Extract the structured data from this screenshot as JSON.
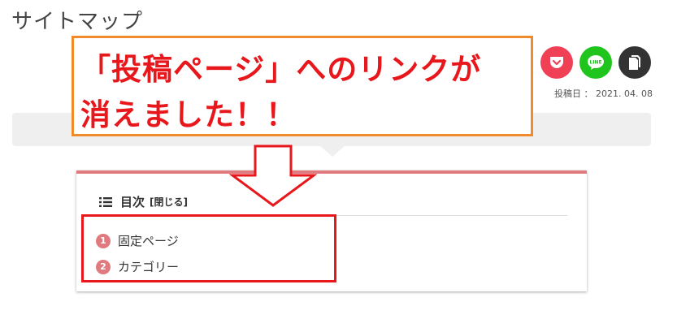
{
  "page": {
    "title": "サイトマップ"
  },
  "share": {
    "pocket_icon": "pocket-icon",
    "line_icon": "line-icon",
    "line_label": "LINE",
    "copy_icon": "copy-icon"
  },
  "post": {
    "date_label": "投稿日 ： 2021. 04. 08"
  },
  "callout": {
    "line1": "「投稿ページ」へのリンクが",
    "line2": "消えました！！",
    "border_color": "#f08a2b",
    "text_color": "#e8171c"
  },
  "toc": {
    "title": "目次",
    "toggle_label": "[閉じる]",
    "accent_color": "#e07a7f",
    "items": [
      {
        "num": "1",
        "label": "固定ページ"
      },
      {
        "num": "2",
        "label": "カテゴリー"
      }
    ]
  },
  "annotation": {
    "frame_color": "#e8171c"
  }
}
